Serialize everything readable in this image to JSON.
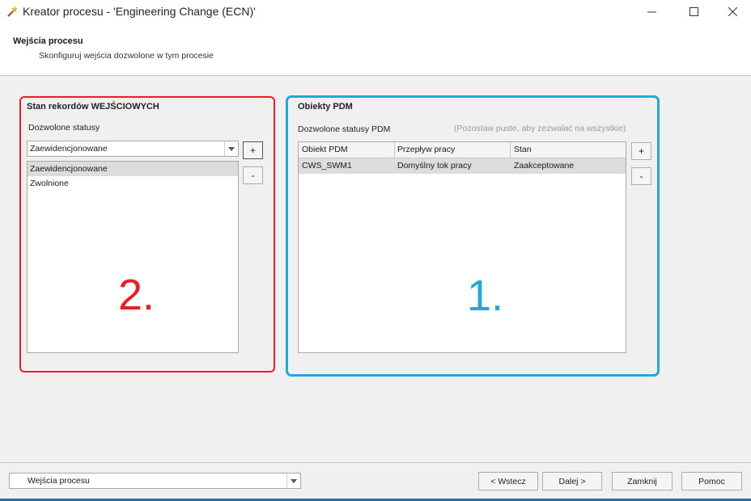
{
  "window": {
    "title": "Kreator procesu - 'Engineering Change (ECN)'",
    "icon": "wizard-wand-icon"
  },
  "header": {
    "title": "Wejścia procesu",
    "subtitle": "Skonfiguruj wejścia dozwolone w tym procesie"
  },
  "left_group": {
    "title": "Stan rekordów WEJŚCIOWYCH",
    "allowed_label": "Dozwolone statusy",
    "combo_value": "Zaewidencjonowane",
    "items": [
      "Zaewidencjonowane",
      "Zwolnione"
    ],
    "add_label": "+",
    "remove_label": "-"
  },
  "right_group": {
    "title": "Obiekty PDM",
    "allowed_label": "Dozwolone statusy PDM",
    "hint": "(Pozostaw puste, aby zezwalać na wszystkie)",
    "columns": [
      "Obiekt PDM",
      "Przepływ pracy",
      "Stan"
    ],
    "rows": [
      [
        "CWS_SWM1",
        "Domyślny tok pracy",
        "Zaakceptowane"
      ]
    ],
    "add_label": "+",
    "remove_label": "-"
  },
  "annotations": {
    "red_label": "2.",
    "blue_label": "1.",
    "red_color": "#ee1c24",
    "blue_color": "#23a8dc"
  },
  "footer": {
    "step_combo_value": "Wejścia procesu",
    "back_label": "< Wstecz",
    "next_label": "Dalej >",
    "close_label": "Zamknij",
    "help_label": "Pomoc"
  }
}
